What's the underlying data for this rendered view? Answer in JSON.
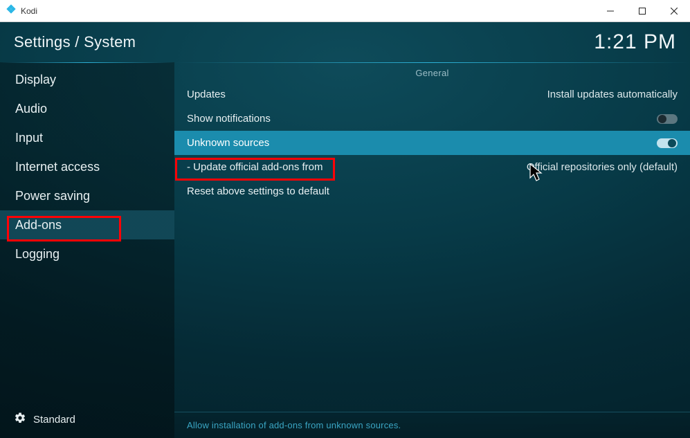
{
  "window": {
    "title": "Kodi"
  },
  "header": {
    "breadcrumb": "Settings / System",
    "clock": "1:21 PM"
  },
  "sidebar": {
    "items": [
      {
        "label": "Display",
        "active": false
      },
      {
        "label": "Audio",
        "active": false
      },
      {
        "label": "Input",
        "active": false
      },
      {
        "label": "Internet access",
        "active": false
      },
      {
        "label": "Power saving",
        "active": false
      },
      {
        "label": "Add-ons",
        "active": true
      },
      {
        "label": "Logging",
        "active": false
      }
    ],
    "level_label": "Standard"
  },
  "content": {
    "section_header": "General",
    "rows": [
      {
        "kind": "select",
        "label": "Updates",
        "value": "Install updates automatically",
        "hover": false,
        "sub": false
      },
      {
        "kind": "toggle",
        "label": "Show notifications",
        "on": false,
        "hover": false,
        "sub": false
      },
      {
        "kind": "toggle",
        "label": "Unknown sources",
        "on": true,
        "hover": true,
        "sub": false
      },
      {
        "kind": "select",
        "label": "Update official add-ons from",
        "value": "Official repositories only (default)",
        "hover": false,
        "sub": true
      },
      {
        "kind": "action",
        "label": "Reset above settings to default",
        "hover": false,
        "sub": false
      }
    ],
    "help_text": "Allow installation of add-ons from unknown sources."
  }
}
